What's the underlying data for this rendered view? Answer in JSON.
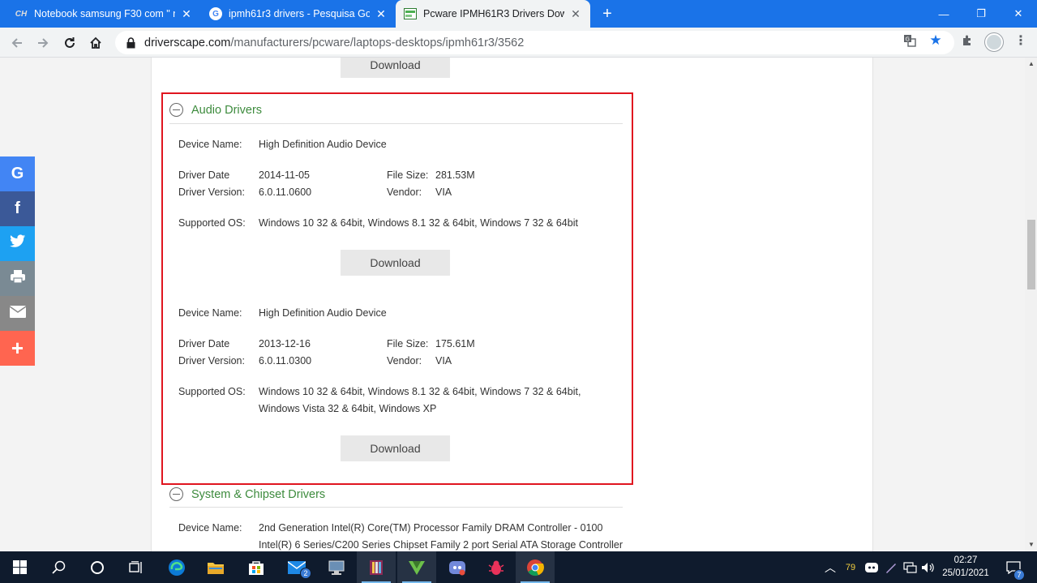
{
  "browser": {
    "tabs": [
      {
        "title": "Notebook samsung F30 com \" não",
        "favicon": "CH",
        "active": false
      },
      {
        "title": "ipmh61r3 drivers - Pesquisa Goo",
        "favicon": "G",
        "active": false
      },
      {
        "title": "Pcware IPMH61R3 Drivers Downlo",
        "favicon": "page-icon",
        "active": true
      }
    ],
    "new_tab_label": "+",
    "url_host": "driverscape.com",
    "url_path": "/manufacturers/pcware/laptops-desktops/ipmh61r3/3562"
  },
  "page": {
    "top_download_label": "Download",
    "audio_section": {
      "title": "Audio Drivers",
      "drivers": [
        {
          "device_name_label": "Device Name:",
          "device_name": "High Definition Audio Device",
          "driver_date_label": "Driver Date",
          "driver_date": "2014-11-05",
          "file_size_label": "File Size:",
          "file_size": "281.53M",
          "driver_version_label": "Driver Version:",
          "driver_version": "6.0.11.0600",
          "vendor_label": "Vendor:",
          "vendor": "VIA",
          "supported_os_label": "Supported OS:",
          "supported_os": "Windows 10 32 & 64bit, Windows 8.1 32 & 64bit, Windows 7 32 & 64bit",
          "supported_os_line2": "",
          "download_label": "Download"
        },
        {
          "device_name_label": "Device Name:",
          "device_name": "High Definition Audio Device",
          "driver_date_label": "Driver Date",
          "driver_date": "2013-12-16",
          "file_size_label": "File Size:",
          "file_size": "175.61M",
          "driver_version_label": "Driver Version:",
          "driver_version": "6.0.11.0300",
          "vendor_label": "Vendor:",
          "vendor": "VIA",
          "supported_os_label": "Supported OS:",
          "supported_os": "Windows 10 32 & 64bit, Windows 8.1 32 & 64bit, Windows 7 32 & 64bit,",
          "supported_os_line2": "Windows Vista 32 & 64bit, Windows XP",
          "download_label": "Download"
        }
      ]
    },
    "chipset_section": {
      "title": "System & Chipset Drivers",
      "device_name_label": "Device Name:",
      "device_lines": [
        "2nd Generation Intel(R) Core(TM) Processor Family DRAM Controller - 0100",
        "Intel(R) 6 Series/C200 Series Chipset Family 2 port Serial ATA Storage Controller"
      ]
    },
    "share_buttons": [
      {
        "name": "google",
        "glyph": "G",
        "color": "#4285f4"
      },
      {
        "name": "facebook",
        "glyph": "f",
        "color": "#3b5998"
      },
      {
        "name": "twitter",
        "glyph": "twitter-icon",
        "color": "#1da1f2"
      },
      {
        "name": "print",
        "glyph": "print-icon",
        "color": "#7a8a94"
      },
      {
        "name": "email",
        "glyph": "mail-icon",
        "color": "#888888"
      },
      {
        "name": "more",
        "glyph": "+",
        "color": "#ff6550"
      }
    ]
  },
  "taskbar": {
    "mail_badge": "2",
    "tray_temp": "79",
    "time": "02:27",
    "date": "25/01/2021",
    "notification_badge": "7"
  },
  "colors": {
    "chrome_blue": "#1a73e8",
    "highlight_red": "#e0151f",
    "section_green": "#3d8b3d",
    "taskbar": "#0f1b2d"
  }
}
